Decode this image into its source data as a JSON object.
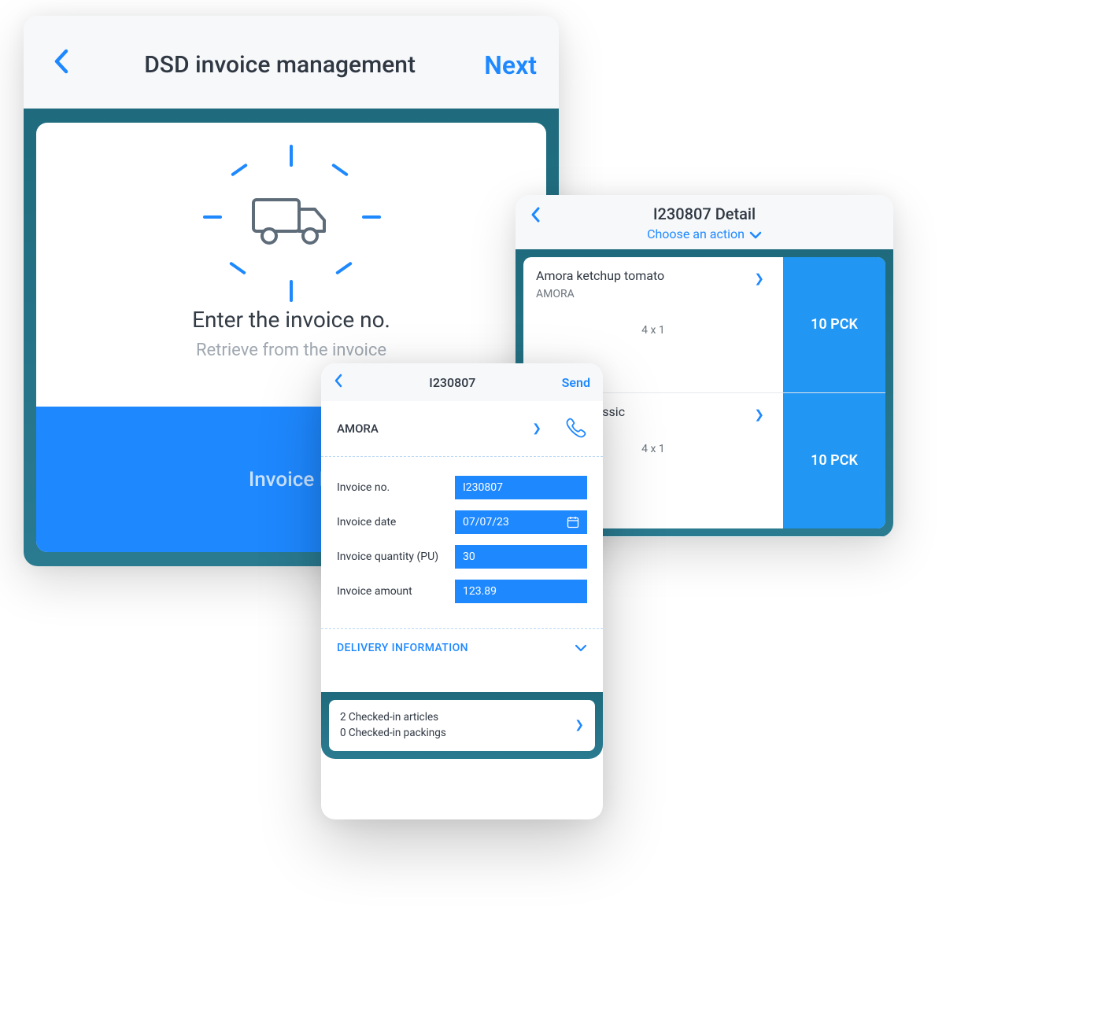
{
  "card1": {
    "title": "DSD invoice management",
    "next": "Next",
    "prompt_heading": "Enter the invoice no.",
    "prompt_sub": "Retrieve from the invoice",
    "input_placeholder": "Invoice N"
  },
  "card2": {
    "title": "I230807",
    "send": "Send",
    "supplier": "AMORA",
    "fields": {
      "invoice_no_label": "Invoice no.",
      "invoice_no_value": "I230807",
      "invoice_date_label": "Invoice date",
      "invoice_date_value": "07/07/23",
      "invoice_qty_label": "Invoice quantity (PU)",
      "invoice_qty_value": "30",
      "invoice_amount_label": "Invoice amount",
      "invoice_amount_value": "123.89"
    },
    "section_label": "DELIVERY INFORMATION",
    "footer_line1": "2 Checked-in articles",
    "footer_line2": "0 Checked-in packings"
  },
  "card3": {
    "title": "I230807 Detail",
    "action": "Choose an action",
    "items": [
      {
        "name": "Amora ketchup tomato",
        "brand": "AMORA",
        "pack": "4 x 1",
        "qty": "10 PCK"
      },
      {
        "name": "mustard classic",
        "brand": "",
        "pack": "4 x 1",
        "qty": "10 PCK"
      }
    ]
  }
}
